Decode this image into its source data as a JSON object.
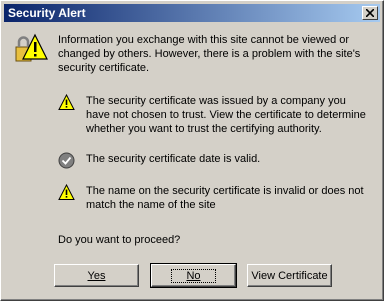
{
  "window": {
    "title": "Security Alert",
    "close_icon": "close-icon"
  },
  "intro": "Information you exchange with this site cannot be viewed or changed by others. However, there is a problem with the site's security certificate.",
  "items": [
    {
      "icon": "warning-icon",
      "text": "The security certificate was issued by a company you have not chosen to trust. View the certificate to determine whether you want to trust the certifying authority."
    },
    {
      "icon": "check-icon",
      "text": "The security certificate date is valid."
    },
    {
      "icon": "warning-icon",
      "text": "The name on the security certificate is invalid or does not match the name of the site"
    }
  ],
  "question": "Do you want to proceed?",
  "buttons": {
    "yes": "Yes",
    "no": "No",
    "view": "View Certificate"
  },
  "colors": {
    "titlebar_start": "#0a246a",
    "titlebar_end": "#a6caf0",
    "warning_yellow": "#ffff00",
    "face": "#d4d0c8"
  }
}
